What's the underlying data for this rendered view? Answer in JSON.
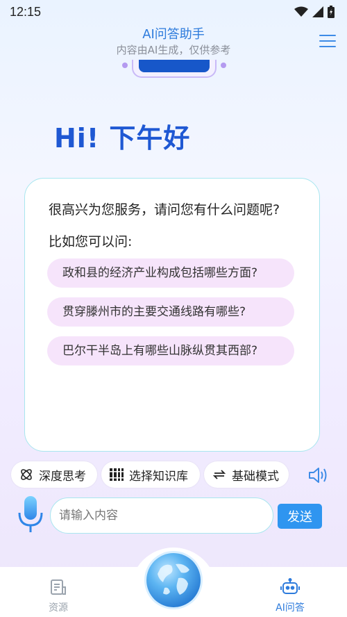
{
  "status_bar": {
    "time": "12:15"
  },
  "header": {
    "title": "AI问答助手",
    "subtitle": "内容由AI生成，仅供参考"
  },
  "greeting": "Hi! 下午好",
  "chat": {
    "welcome": "很高兴为您服务，请问您有什么问题呢?",
    "suggest_label": "比如您可以问:",
    "suggestions": [
      "政和县的经济产业构成包括哪些方面?",
      "贯穿滕州市的主要交通线路有哪些?",
      "巴尔干半岛上有哪些山脉纵贯其西部?"
    ]
  },
  "toolbar": {
    "deep_think": {
      "label": "深度思考",
      "icon": "atom-icon"
    },
    "knowledge_base": {
      "label": "选择知识库",
      "icon": "books-icon"
    },
    "mode": {
      "label": "基础模式",
      "icon": "swap-icon"
    },
    "speaker_icon": "speaker-icon"
  },
  "input": {
    "placeholder": "请输入内容",
    "value": "",
    "send_label": "发送",
    "mic_icon": "microphone-icon"
  },
  "bottom_nav": {
    "resources": {
      "label": "资源",
      "icon": "document-icon"
    },
    "center": {
      "icon": "globe-icon"
    },
    "ai_qa": {
      "label": "AI问答",
      "icon": "robot-icon"
    }
  },
  "colors": {
    "accent": "#2d7bdc",
    "greeting": "#1f58d3",
    "chip_bg": "#f6e4fb",
    "card_border": "#a8e6ef",
    "send_bg": "#2f95f0",
    "nav_inactive": "#9aa3ad",
    "nav_active": "#2d7bdc"
  }
}
